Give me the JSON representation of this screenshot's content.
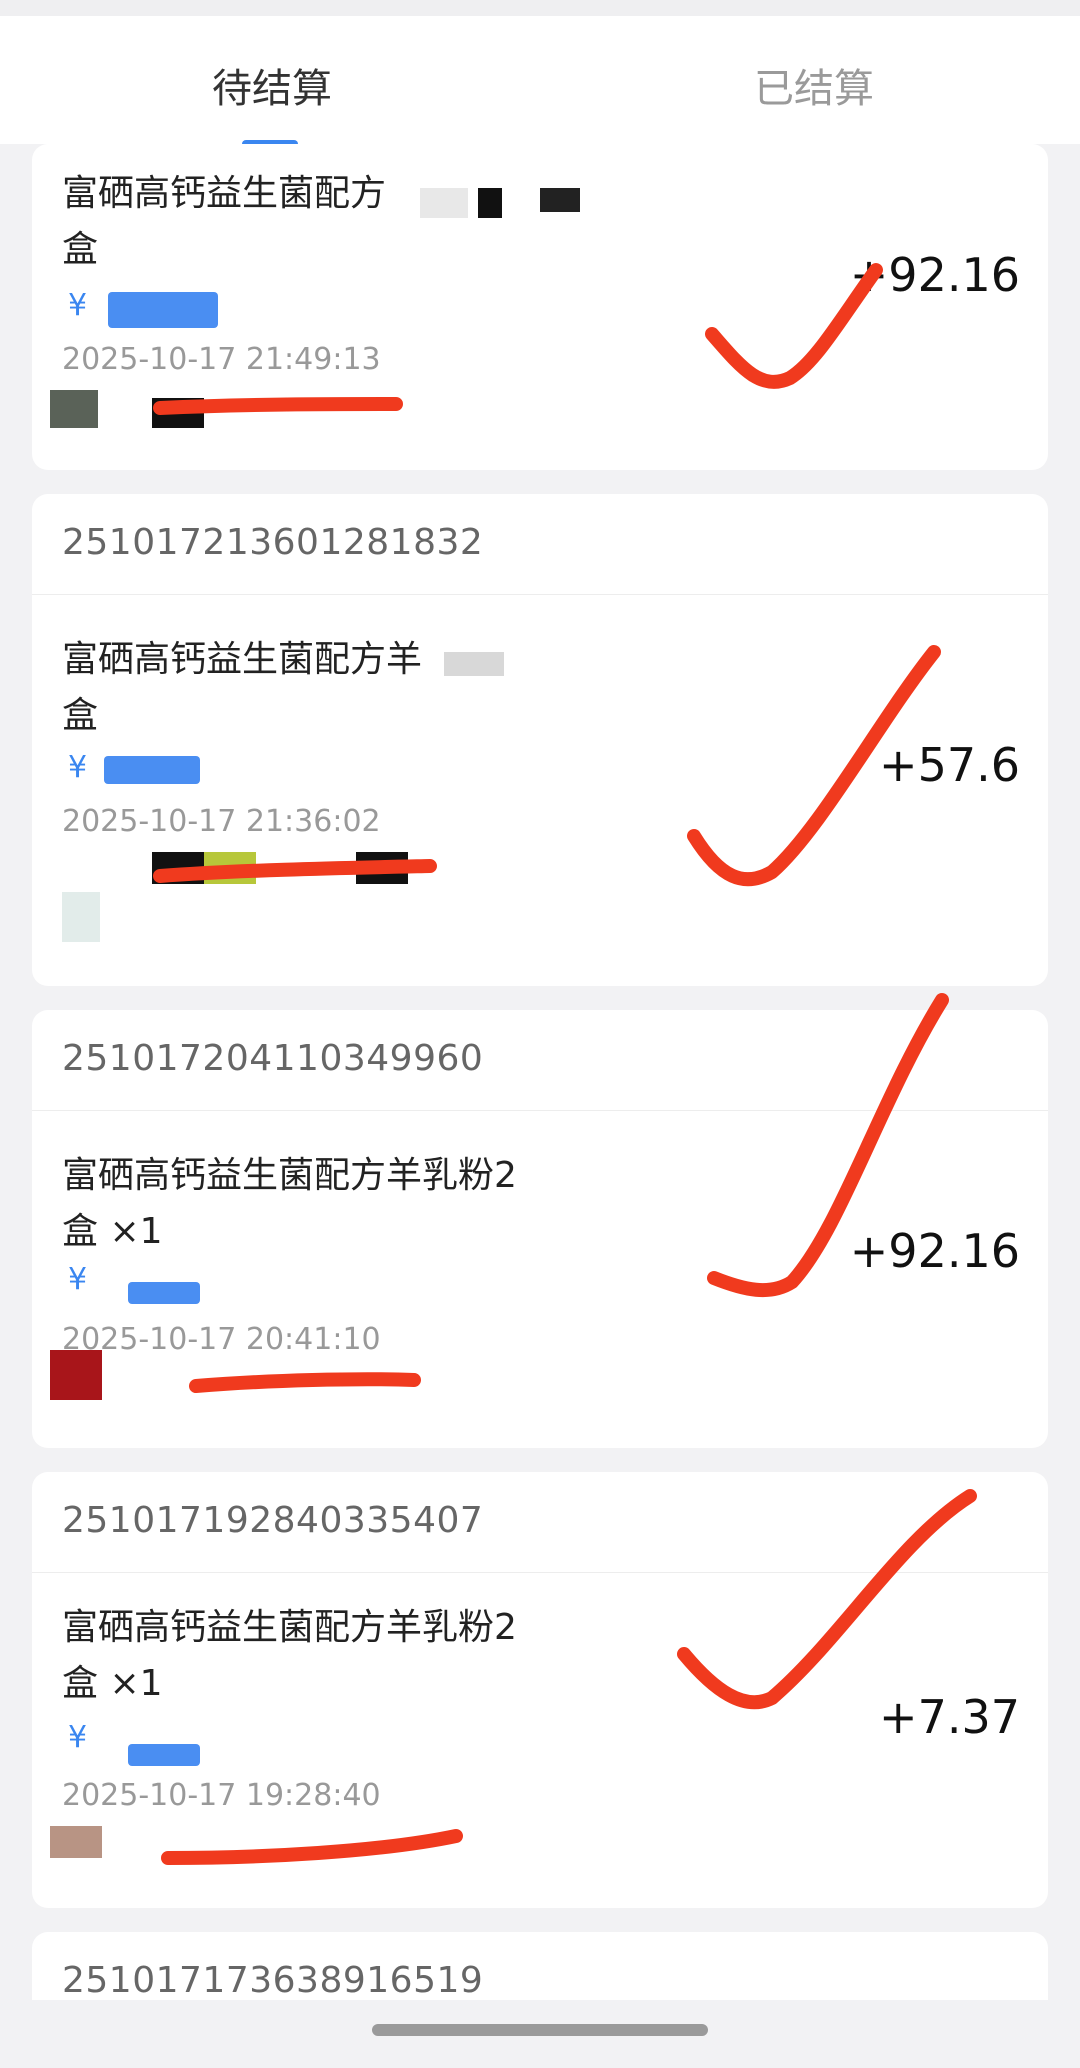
{
  "tabs": [
    {
      "label": "待结算",
      "active": true
    },
    {
      "label": "已结算",
      "active": false
    }
  ],
  "orders": [
    {
      "order_no": "",
      "product": "富硒高钙益生菌配方",
      "product_line2": "盒",
      "price_symbol": "¥",
      "time": "2025-10-17 21:49:13",
      "amount": "+92.16"
    },
    {
      "order_no": "251017213601281832",
      "product": "富硒高钙益生菌配方羊",
      "product_line2": "盒",
      "price_symbol": "¥",
      "time": "2025-10-17 21:36:02",
      "amount": "+57.6"
    },
    {
      "order_no": "251017204110349960",
      "product": "富硒高钙益生菌配方羊乳粉2",
      "product_line2": "盒 ×1",
      "price_symbol": "¥",
      "time": "2025-10-17 20:41:10",
      "amount": "+92.16"
    },
    {
      "order_no": "251017192840335407",
      "product": "富硒高钙益生菌配方羊乳粉2",
      "product_line2": "盒 ×1",
      "price_symbol": "¥",
      "time": "2025-10-17 19:28:40",
      "amount": "+7.37"
    },
    {
      "order_no": "251017173638916519"
    }
  ],
  "colors": {
    "accent": "#3a86f0",
    "annotation": "#f03a1e"
  }
}
